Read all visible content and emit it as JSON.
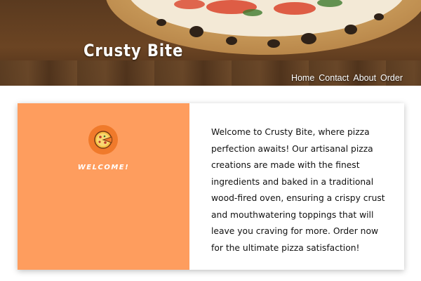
{
  "header": {
    "brand": "Crusty Bite",
    "nav": [
      {
        "label": "Home"
      },
      {
        "label": "Contact"
      },
      {
        "label": "About"
      },
      {
        "label": "Order"
      }
    ]
  },
  "intro": {
    "icon": "pizza-icon",
    "welcome_label": "WELCOME!",
    "paragraph": "Welcome to Crusty Bite, where pizza perfection awaits! Our artisanal pizza creations are made with the finest ingredients and baked in a traditional wood-fired oven, ensuring a crispy crust and mouthwatering toppings that will leave you craving for more. Order now for the ultimate pizza satisfaction!"
  },
  "colors": {
    "panel": "#fe9d5e",
    "badge": "#f07a2b"
  }
}
